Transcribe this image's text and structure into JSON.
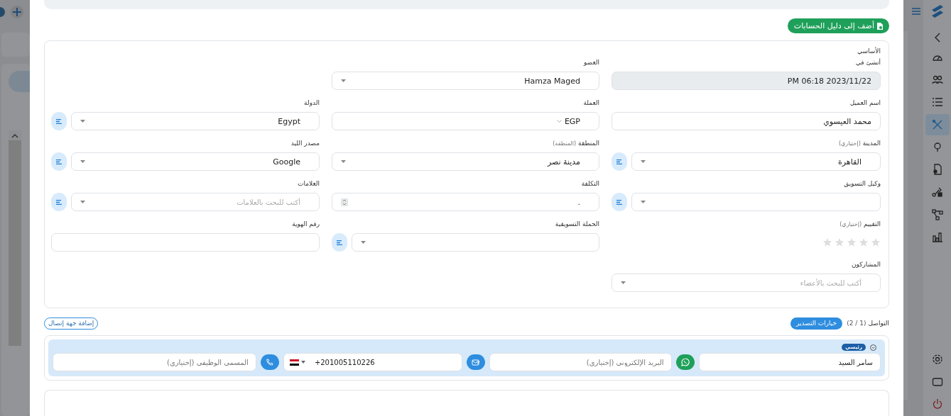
{
  "add_to_accounts_button": "أضف إلى دليل الحسابات",
  "basic": {
    "title": "الأساسي",
    "rows": [
      [
        {
          "label": "أنشئ في",
          "kind": "readonly",
          "value": "PM 06:18 2023/11/22",
          "side_button": false
        },
        {
          "label": "العضو",
          "kind": "select",
          "value": "Hamza Maged",
          "side_button": false
        },
        null
      ],
      [
        {
          "label": "اسم العميل",
          "kind": "input",
          "value": "محمد العيسوي",
          "side_button": false
        },
        {
          "label": "العملة",
          "kind": "select_plain",
          "value": "EGP",
          "side_button": false
        },
        {
          "label": "الدولة",
          "kind": "select",
          "value": "Egypt",
          "side_button": true
        }
      ],
      [
        {
          "label": "المدينة",
          "hint": "(إختياري)",
          "kind": "select",
          "value": "القاهرة",
          "side_button": true
        },
        {
          "label": "المنطقة",
          "hint": "(المنطقة)",
          "kind": "select",
          "value": "مدينة نصر",
          "side_button": false
        },
        {
          "label": "مصدر الليد",
          "kind": "select",
          "value": "Google",
          "side_button": true
        }
      ],
      [
        {
          "label": "وكيل التسويق",
          "kind": "select",
          "side_button": true
        },
        {
          "label": "التكلفة",
          "kind": "number",
          "value": ".",
          "side_button": false
        },
        {
          "label": "العلامات",
          "kind": "select",
          "placeholder": "أكتب للبحث بالعلامات",
          "side_button": true
        }
      ],
      [
        {
          "label": "التقييم",
          "hint": "(إختياري)",
          "kind": "stars",
          "stars": 0,
          "side_button": false
        },
        {
          "label": "الحملة التسويقية",
          "kind": "select",
          "side_button": true
        },
        {
          "label": "رقم الهوية",
          "kind": "input",
          "side_button": false
        }
      ],
      [
        {
          "label": "المشاركون",
          "kind": "select",
          "placeholder": "أكتب للبحث بالأعضاء",
          "side_button": false
        },
        null,
        null
      ]
    ]
  },
  "contacts": {
    "title": "التواصل",
    "count": "(1 / 2)",
    "export_button": "خيارات التصدير",
    "add_button": "إضافة جهة إتصال",
    "items": [
      {
        "badge": "رئيسي",
        "expanded": true,
        "fields": [
          {
            "kind": "input",
            "value": "سامر السيد"
          },
          {
            "kind": "whatsapp"
          },
          {
            "kind": "input",
            "placeholder": "البريد الإلكتروني (إختياري)"
          },
          {
            "kind": "email"
          },
          {
            "kind": "phone",
            "value": "+201005110226"
          },
          {
            "kind": "call"
          },
          {
            "kind": "input",
            "placeholder": "المسمي الوظيفي (إختياري)"
          }
        ]
      }
    ]
  },
  "sidebar": {
    "items": [
      {
        "kind": "gauge",
        "selected": false
      },
      {
        "kind": "users",
        "selected": false
      },
      {
        "kind": "list",
        "selected": false
      },
      {
        "kind": "tools",
        "selected": true
      },
      {
        "kind": "help",
        "selected": false
      },
      {
        "kind": "document",
        "selected": false
      },
      {
        "kind": "share",
        "selected": false
      },
      {
        "kind": "hierarchy",
        "selected": false
      },
      {
        "kind": "chart",
        "selected": false
      }
    ],
    "bottom_items": [
      {
        "kind": "settings"
      },
      {
        "kind": "window"
      },
      {
        "kind": "power"
      }
    ]
  }
}
